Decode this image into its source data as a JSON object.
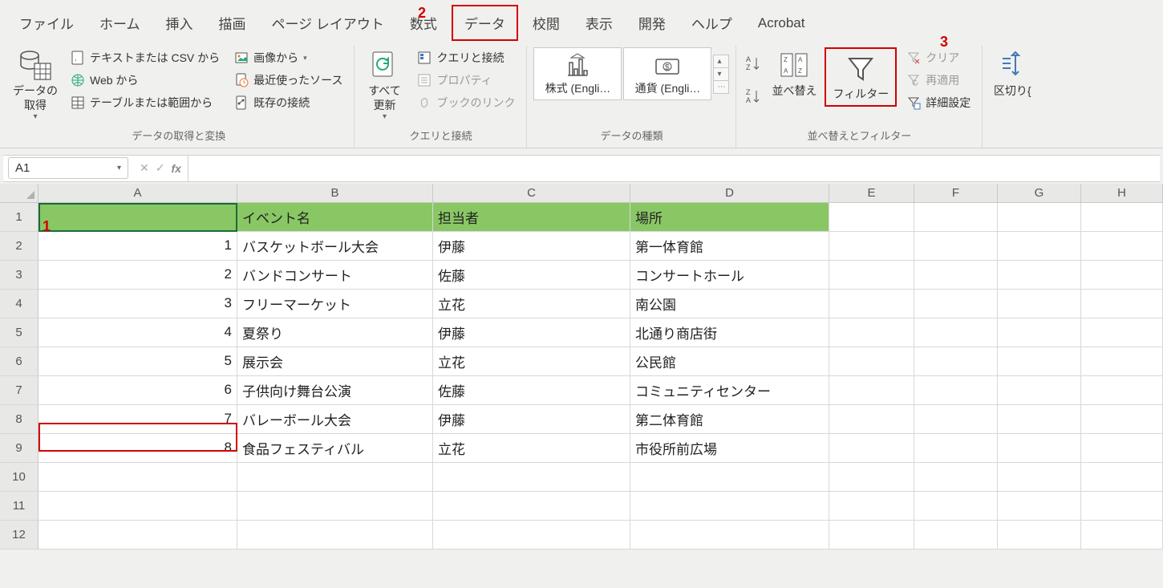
{
  "tabs": [
    "ファイル",
    "ホーム",
    "挿入",
    "描画",
    "ページ レイアウト",
    "数式",
    "データ",
    "校閲",
    "表示",
    "開発",
    "ヘルプ",
    "Acrobat"
  ],
  "active_tab_index": 6,
  "annotations": {
    "a1": "1",
    "a2": "2",
    "a3": "3"
  },
  "ribbon": {
    "group1": {
      "getdata": "データの\n取得",
      "csv": "テキストまたは CSV から",
      "img": "画像から",
      "web": "Web から",
      "recent": "最近使ったソース",
      "table": "テーブルまたは範囲から",
      "existing": "既存の接続",
      "label": "データの取得と変換"
    },
    "group2": {
      "refresh": "すべて\n更新",
      "queries": "クエリと接続",
      "prop": "プロパティ",
      "link": "ブックのリンク",
      "label": "クエリと接続"
    },
    "group3": {
      "stocks": "株式 (Engli…",
      "currency": "通貨 (Engli…",
      "label": "データの種類"
    },
    "group4": {
      "sort": "並べ替え",
      "filter": "フィルター",
      "clear": "クリア",
      "reapply": "再適用",
      "adv": "詳細設定",
      "label": "並べ替えとフィルター"
    },
    "group5": {
      "textcol": "区切り{"
    }
  },
  "namebox": "A1",
  "formula": "",
  "columns": [
    "A",
    "B",
    "C",
    "D",
    "E",
    "F",
    "G",
    "H"
  ],
  "header_row": [
    "",
    "イベント名",
    "担当者",
    "場所"
  ],
  "rows": [
    [
      "1",
      "バスケットボール大会",
      "伊藤",
      "第一体育館"
    ],
    [
      "2",
      "バンドコンサート",
      "佐藤",
      "コンサートホール"
    ],
    [
      "3",
      "フリーマーケット",
      "立花",
      "南公園"
    ],
    [
      "4",
      "夏祭り",
      "伊藤",
      "北通り商店街"
    ],
    [
      "5",
      "展示会",
      "立花",
      "公民館"
    ],
    [
      "6",
      "子供向け舞台公演",
      "佐藤",
      "コミュニティセンター"
    ],
    [
      "7",
      "バレーボール大会",
      "伊藤",
      "第二体育館"
    ],
    [
      "8",
      "食品フェスティバル",
      "立花",
      "市役所前広場"
    ]
  ],
  "empty_rows": [
    "10",
    "11",
    "12"
  ]
}
